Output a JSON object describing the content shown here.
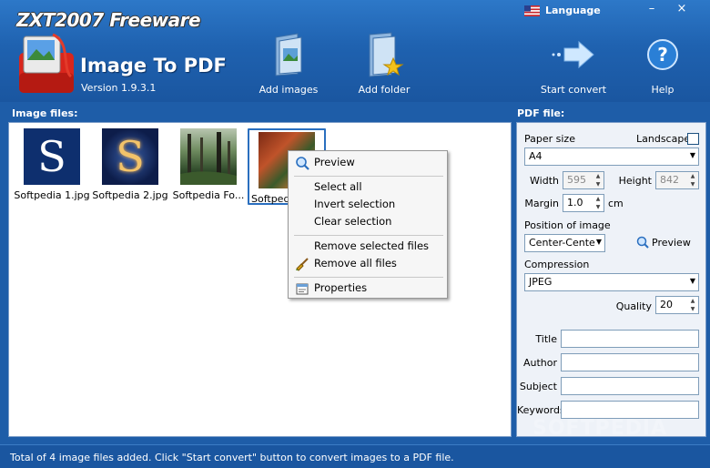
{
  "window": {
    "brand": "ZXT2007 Freeware",
    "title": "Image To PDF",
    "version": "Version 1.9.3.1",
    "language_label": "Language",
    "min_glyph": "–",
    "close_glyph": "×"
  },
  "toolbar": {
    "add_images": "Add images",
    "add_folder": "Add folder",
    "start_convert": "Start convert",
    "help": "Help"
  },
  "files": {
    "label": "Image files:",
    "items": [
      {
        "name": "Softpedia 1.jpg"
      },
      {
        "name": "Softpedia 2.jpg"
      },
      {
        "name": "Softpedia Fo..."
      },
      {
        "name": "Softpedia"
      }
    ]
  },
  "context_menu": {
    "preview": "Preview",
    "select_all": "Select all",
    "invert_selection": "Invert selection",
    "clear_selection": "Clear selection",
    "remove_selected": "Remove selected files",
    "remove_all": "Remove all files",
    "properties": "Properties"
  },
  "pdf": {
    "label": "PDF file:",
    "paper_size_label": "Paper size",
    "landscape_label": "Landscape",
    "paper_size_value": "A4",
    "width_label": "Width",
    "width_value": "595",
    "height_label": "Height",
    "height_value": "842",
    "margin_label": "Margin",
    "margin_value": "1.0",
    "margin_unit": "cm",
    "position_label": "Position of image",
    "position_value": "Center-Cente",
    "preview_label": "Preview",
    "compression_label": "Compression",
    "compression_value": "JPEG",
    "quality_label": "Quality",
    "quality_value": "20",
    "title_label": "Title",
    "author_label": "Author",
    "subject_label": "Subject",
    "keywords_label": "Keywords"
  },
  "status": {
    "text": "Total of 4 image files added. Click \"Start convert\" button to convert images to a PDF file."
  },
  "watermark": "SOFTPEDIA"
}
